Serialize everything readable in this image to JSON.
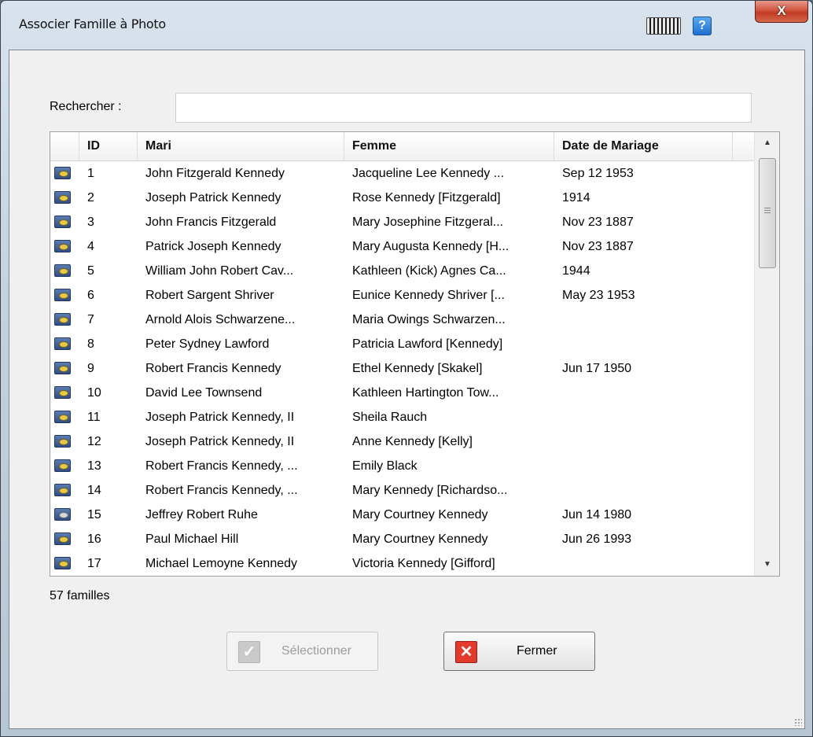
{
  "window": {
    "title": "Associer Famille à Photo",
    "close_glyph": "X",
    "help_glyph": "?",
    "keyboard_icon": "keyboard-icon"
  },
  "search": {
    "label": "Rechercher :",
    "value": "",
    "placeholder": ""
  },
  "table": {
    "columns": [
      "ID",
      "Mari",
      "Femme",
      "Date de Mariage"
    ],
    "rows": [
      {
        "icon": "family-photo-icon",
        "id": "1",
        "mari": "John Fitzgerald Kennedy",
        "femme": "Jacqueline Lee Kennedy ...",
        "date": "Sep 12 1953"
      },
      {
        "icon": "family-photo-icon",
        "id": "2",
        "mari": "Joseph Patrick Kennedy",
        "femme": "Rose Kennedy [Fitzgerald]",
        "date": "1914"
      },
      {
        "icon": "family-photo-icon",
        "id": "3",
        "mari": "John Francis Fitzgerald",
        "femme": "Mary Josephine Fitzgeral...",
        "date": "Nov 23 1887"
      },
      {
        "icon": "family-photo-icon",
        "id": "4",
        "mari": "Patrick Joseph Kennedy",
        "femme": "Mary Augusta Kennedy [H...",
        "date": "Nov 23 1887"
      },
      {
        "icon": "family-photo-icon",
        "id": "5",
        "mari": "William John Robert Cav...",
        "femme": "Kathleen (Kick) Agnes Ca...",
        "date": "1944"
      },
      {
        "icon": "family-photo-icon",
        "id": "6",
        "mari": "Robert Sargent Shriver",
        "femme": "Eunice Kennedy Shriver [...",
        "date": "May 23 1953"
      },
      {
        "icon": "family-photo-icon",
        "id": "7",
        "mari": "Arnold Alois Schwarzene...",
        "femme": "Maria Owings Schwarzen...",
        "date": ""
      },
      {
        "icon": "family-photo-icon",
        "id": "8",
        "mari": "Peter Sydney Lawford",
        "femme": "Patricia Lawford [Kennedy]",
        "date": ""
      },
      {
        "icon": "family-photo-icon",
        "id": "9",
        "mari": "Robert Francis Kennedy",
        "femme": "Ethel Kennedy [Skakel]",
        "date": "Jun 17 1950"
      },
      {
        "icon": "family-photo-icon",
        "id": "10",
        "mari": "David Lee Townsend",
        "femme": "Kathleen Hartington Tow...",
        "date": ""
      },
      {
        "icon": "family-photo-icon",
        "id": "11",
        "mari": "Joseph Patrick Kennedy, II",
        "femme": "Sheila Rauch",
        "date": ""
      },
      {
        "icon": "family-photo-icon",
        "id": "12",
        "mari": "Joseph Patrick Kennedy, II",
        "femme": "Anne Kennedy [Kelly]",
        "date": ""
      },
      {
        "icon": "family-photo-icon",
        "id": "13",
        "mari": "Robert Francis Kennedy, ...",
        "femme": "Emily Black",
        "date": ""
      },
      {
        "icon": "family-photo-icon",
        "id": "14",
        "mari": "Robert Francis Kennedy, ...",
        "femme": "Mary Kennedy [Richardso...",
        "date": ""
      },
      {
        "icon": "family-photo-alt-icon",
        "id": "15",
        "mari": "Jeffrey Robert Ruhe",
        "femme": "Mary Courtney Kennedy",
        "date": "Jun 14 1980"
      },
      {
        "icon": "family-photo-icon",
        "id": "16",
        "mari": "Paul Michael Hill",
        "femme": "Mary Courtney Kennedy",
        "date": "Jun 26 1993"
      },
      {
        "icon": "family-photo-icon",
        "id": "17",
        "mari": "Michael Lemoyne Kennedy",
        "femme": "Victoria Kennedy [Gifford]",
        "date": ""
      }
    ]
  },
  "status": {
    "count": "57 familles"
  },
  "buttons": {
    "select_label": "Sélectionner",
    "select_enabled": false,
    "close_label": "Fermer"
  },
  "colors": {
    "close_button": "#c13b22",
    "help_button": "#1d6fd0",
    "fermer_icon": "#e23a2c"
  }
}
